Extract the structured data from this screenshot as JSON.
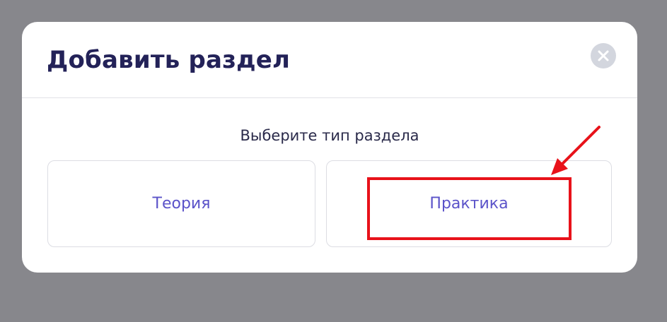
{
  "modal": {
    "title": "Добавить раздел",
    "close_icon": "close-icon",
    "subtitle": "Выберите тип раздела",
    "options": [
      {
        "label": "Теория"
      },
      {
        "label": "Практика"
      }
    ]
  },
  "annotation": {
    "highlight_color": "#e8121a",
    "arrow_icon": "arrow-pointer-icon"
  },
  "colors": {
    "backdrop": "#87878c",
    "title": "#232258",
    "option_text": "#5b53c9"
  }
}
